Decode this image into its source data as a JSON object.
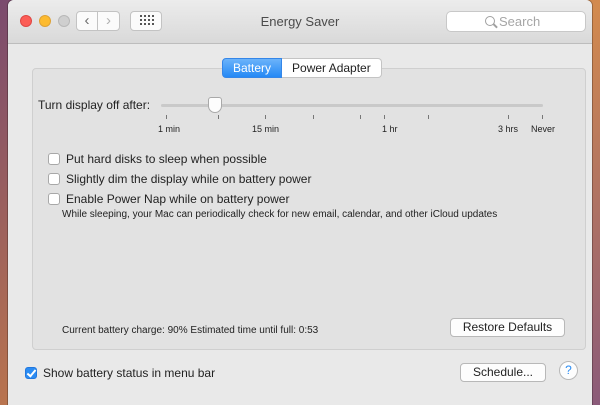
{
  "window": {
    "title": "Energy Saver",
    "search_placeholder": "Search",
    "nav_back": "‹",
    "nav_forward": "›"
  },
  "tabs": [
    {
      "label": "Battery",
      "selected": true
    },
    {
      "label": "Power Adapter",
      "selected": false
    }
  ],
  "slider": {
    "label": "Turn display off after:",
    "ticks": [
      "1 min",
      "15 min",
      "1 hr",
      "3 hrs",
      "Never"
    ]
  },
  "options": [
    {
      "label": "Put hard disks to sleep when possible",
      "checked": false
    },
    {
      "label": "Slightly dim the display while on battery power",
      "checked": false
    },
    {
      "label": "Enable Power Nap while on battery power",
      "checked": false
    }
  ],
  "power_nap_note": "While sleeping, your Mac can periodically check for new email, calendar, and other iCloud updates",
  "status_text": "Current battery charge: 90%  Estimated time until full: 0:53",
  "buttons": {
    "restore": "Restore Defaults",
    "schedule": "Schedule...",
    "help": "?"
  },
  "show_battery_status": {
    "label": "Show battery status in menu bar",
    "checked": true
  },
  "colors": {
    "accent": "#2b8cf3"
  }
}
